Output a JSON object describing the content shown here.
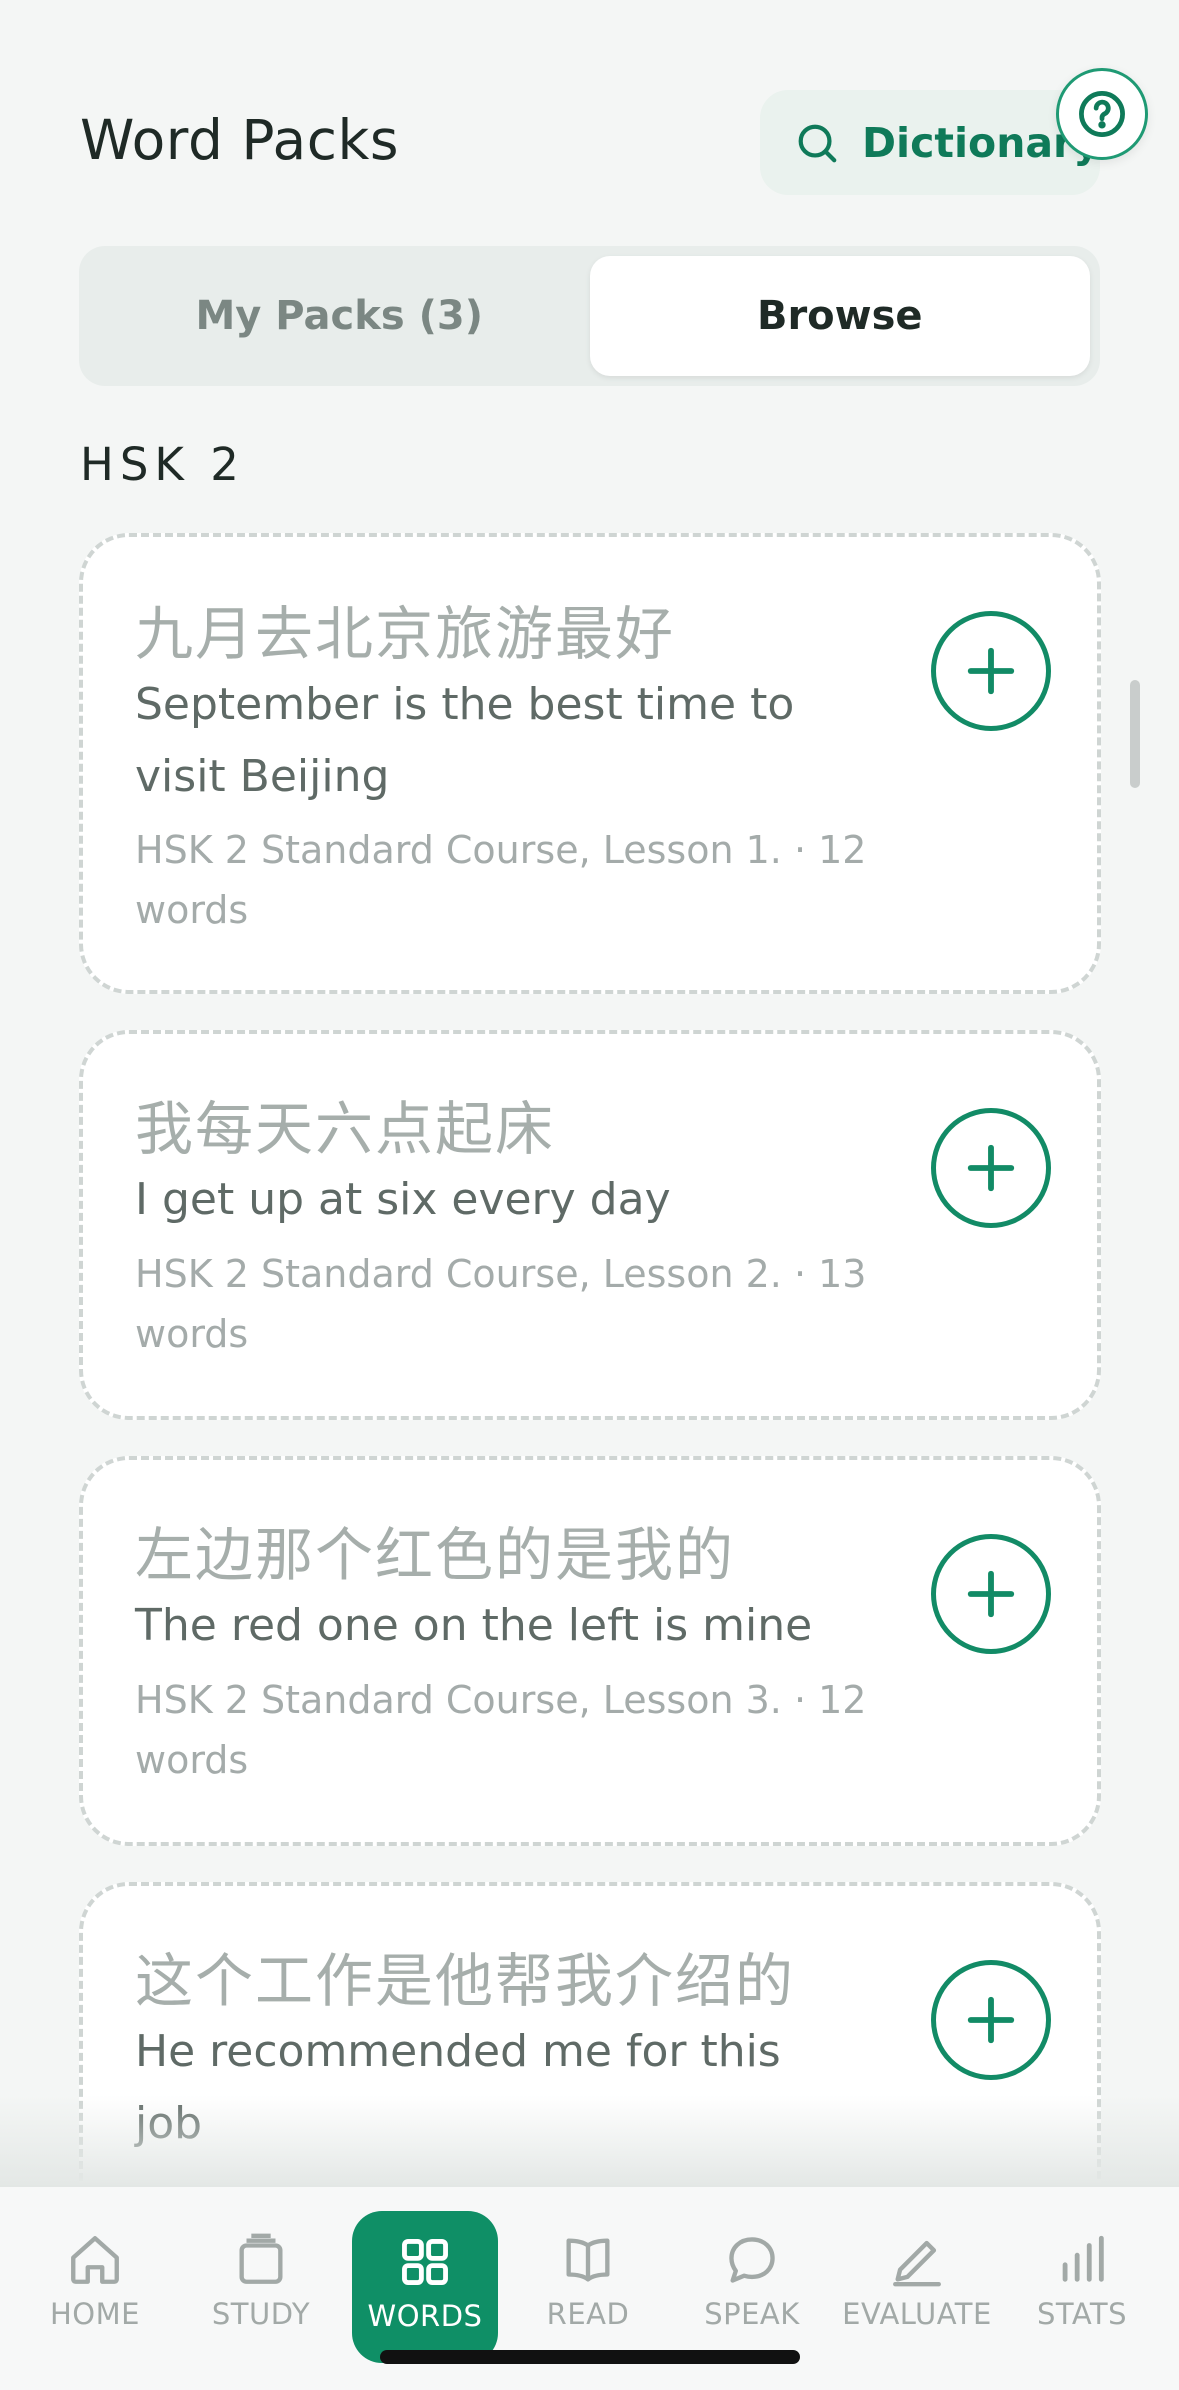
{
  "header": {
    "title": "Word Packs",
    "dictionary_label": "Dictionary"
  },
  "segmented": {
    "my_packs_label": "My Packs (3)",
    "browse_label": "Browse",
    "active": "Browse"
  },
  "section": {
    "label": "HSK 2"
  },
  "packs": [
    {
      "chinese": "九月去北京旅游最好",
      "english_lines": [
        "September is the best time to",
        "visit Beijing"
      ],
      "meta_lines": [
        "HSK 2 Standard Course, Lesson 1. · 12",
        "words"
      ]
    },
    {
      "chinese": "我每天六点起床",
      "english_lines": [
        "I get up at six every day"
      ],
      "meta_lines": [
        "HSK 2 Standard Course, Lesson 2. · 13",
        "words"
      ]
    },
    {
      "chinese": "左边那个红色的是我的",
      "english_lines": [
        "The red one on the left is mine"
      ],
      "meta_lines": [
        "HSK 2 Standard Course, Lesson 3. · 12",
        "words"
      ]
    },
    {
      "chinese": "这个工作是他帮我介绍的",
      "english_lines": [
        "He recommended me for this job"
      ],
      "meta_lines": []
    }
  ],
  "tabbar": {
    "items": [
      {
        "label": "HOME",
        "icon": "home-icon"
      },
      {
        "label": "STUDY",
        "icon": "cards-icon"
      },
      {
        "label": "WORDS",
        "icon": "grid-icon"
      },
      {
        "label": "READ",
        "icon": "book-icon"
      },
      {
        "label": "SPEAK",
        "icon": "chat-bubble-icon"
      },
      {
        "label": "EVALUATE",
        "icon": "pencil-icon"
      },
      {
        "label": "STATS",
        "icon": "bar-chart-icon"
      }
    ],
    "active": "WORDS"
  },
  "colors": {
    "accent": "#0f8f66",
    "accent_dark": "#0f7a59",
    "background": "#f4f6f5"
  }
}
